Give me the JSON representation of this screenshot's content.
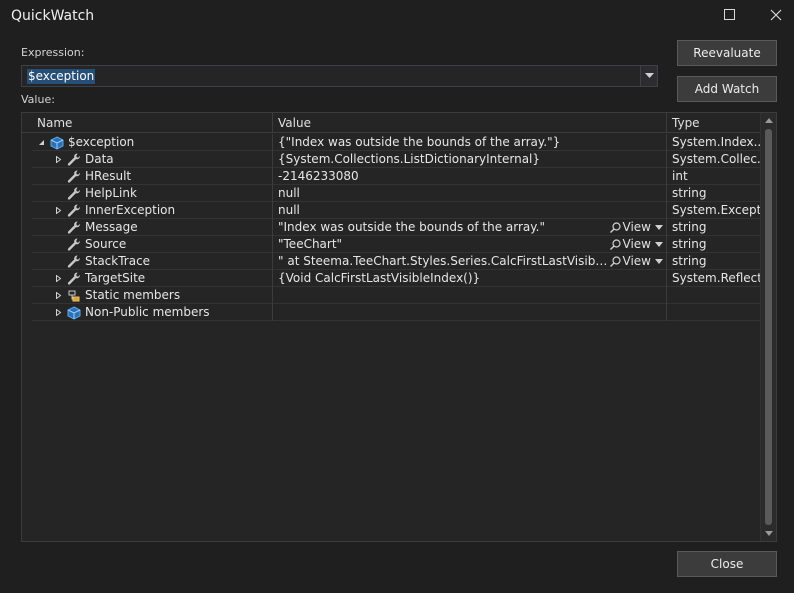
{
  "window": {
    "title": "QuickWatch"
  },
  "expression": {
    "label": "Expression:",
    "value": "$exception"
  },
  "value_label": "Value:",
  "buttons": {
    "reevaluate": "Reevaluate",
    "add_watch": "Add Watch",
    "close": "Close"
  },
  "columns": {
    "name": "Name",
    "value": "Value",
    "type": "Type"
  },
  "rows": [
    {
      "name": "$exception",
      "value": "{\"Index was outside the bounds of the array.\"}",
      "type": "System.Index...",
      "icon": "object-icon",
      "expander": "expanded",
      "indent": 0
    },
    {
      "name": "Data",
      "value": "{System.Collections.ListDictionaryInternal}",
      "type": "System.Collec...",
      "icon": "wrench-icon",
      "expander": "collapsed",
      "indent": 1
    },
    {
      "name": "HResult",
      "value": "-2146233080",
      "type": "int",
      "icon": "wrench-icon",
      "expander": "none",
      "indent": 1
    },
    {
      "name": "HelpLink",
      "value": "null",
      "type": "string",
      "icon": "wrench-icon",
      "expander": "none",
      "indent": 1
    },
    {
      "name": "InnerException",
      "value": "null",
      "type": "System.Except...",
      "icon": "wrench-icon",
      "expander": "collapsed",
      "indent": 1
    },
    {
      "name": "Message",
      "value": "\"Index was outside the bounds of the array.\"",
      "type": "string",
      "icon": "wrench-icon",
      "expander": "none",
      "indent": 1,
      "view": "View"
    },
    {
      "name": "Source",
      "value": "\"TeeChart\"",
      "type": "string",
      "icon": "wrench-icon",
      "expander": "none",
      "indent": 1,
      "view": "View"
    },
    {
      "name": "StackTrace",
      "value": "\"   at Steema.TeeChart.Styles.Series.CalcFirstLastVisibleIndex()...",
      "type": "string",
      "icon": "wrench-icon",
      "expander": "none",
      "indent": 1,
      "view": "View"
    },
    {
      "name": "TargetSite",
      "value": "{Void CalcFirstLastVisibleIndex()}",
      "type": "System.Reflect...",
      "icon": "wrench-icon",
      "expander": "collapsed",
      "indent": 1
    },
    {
      "name": "Static members",
      "value": "",
      "type": "",
      "icon": "static-members-icon",
      "expander": "collapsed",
      "indent": 1
    },
    {
      "name": "Non-Public members",
      "value": "",
      "type": "",
      "icon": "object-icon",
      "expander": "collapsed",
      "indent": 1
    }
  ],
  "colors": {
    "background": "#1f1f1f",
    "selection": "#264f78",
    "grid_bg": "#252526",
    "icon_blue": "#3c8fdc"
  }
}
